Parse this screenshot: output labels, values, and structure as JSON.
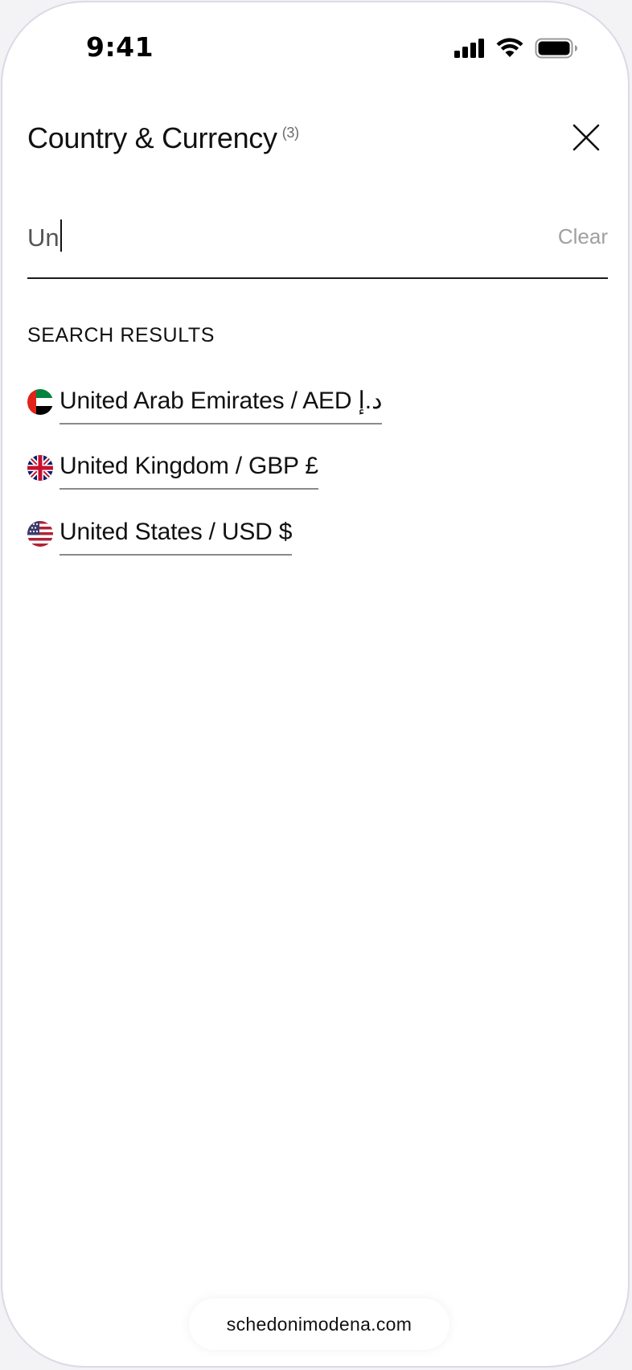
{
  "status_bar": {
    "time": "9:41"
  },
  "header": {
    "title": "Country & Currency",
    "count": "(3)"
  },
  "search": {
    "value": "Un",
    "clear_label": "Clear"
  },
  "results": {
    "heading": "SEARCH RESULTS",
    "items": [
      {
        "label": "United Arab Emirates / AED د.إ",
        "flag": "uae-flag-icon"
      },
      {
        "label": "United Kingdom / GBP £",
        "flag": "uk-flag-icon"
      },
      {
        "label": "United States / USD $",
        "flag": "us-flag-icon"
      }
    ]
  },
  "browser": {
    "url": "schedonimodena.com"
  },
  "colors": {
    "text": "#111111",
    "muted": "#a0a0a0",
    "underline": "#8a8a8a",
    "frame": "#d9dbe6"
  }
}
